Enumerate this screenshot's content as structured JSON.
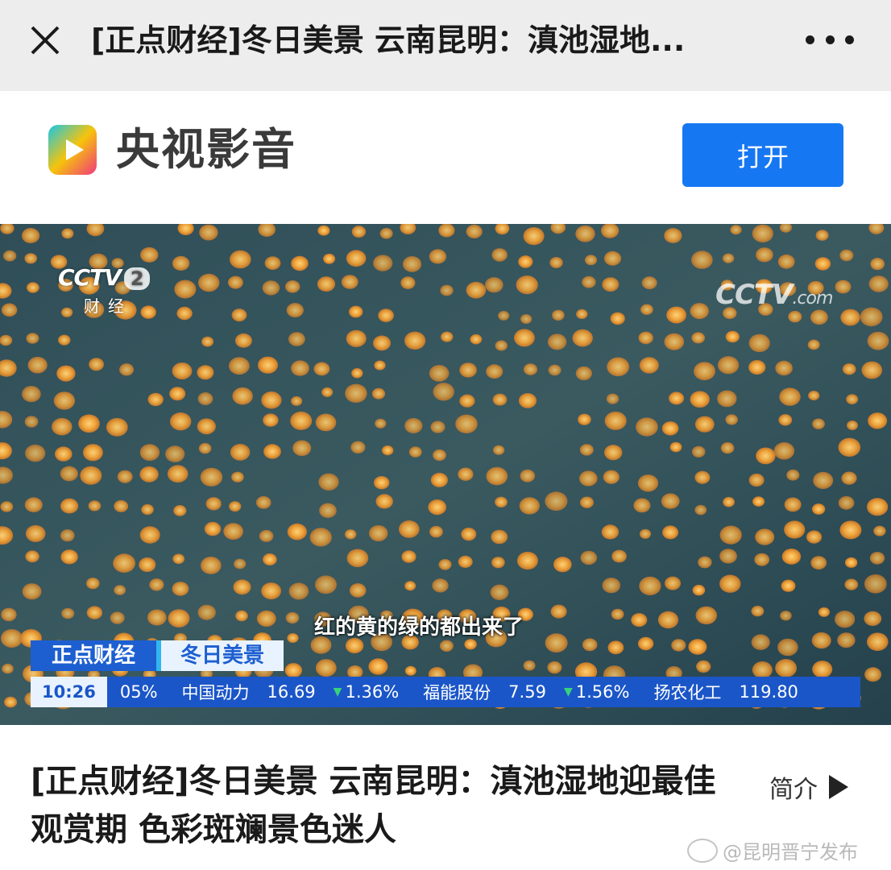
{
  "topbar": {
    "title": "[正点财经]冬日美景 云南昆明：滇池湿地...",
    "close_icon": "close-icon",
    "more_icon": "more-dots-icon"
  },
  "banner": {
    "app_name": "央视影音",
    "open_label": "打开",
    "accent_color": "#1677f2"
  },
  "video": {
    "channel_logo": "CCTV",
    "channel_number": "2",
    "channel_sub": "财经",
    "watermark": "CCTV",
    "watermark_suffix": ".com",
    "subtitle": "红的黄的绿的都出来了",
    "program": "正点财经",
    "segment": "冬日美景",
    "ticker": {
      "time": "10:26",
      "lead_value": "05%",
      "stocks": [
        {
          "name": "中国动力",
          "price": "16.69",
          "change": "1.36%"
        },
        {
          "name": "福能股份",
          "price": "7.59",
          "change": "1.56%"
        },
        {
          "name": "扬农化工",
          "price": "119.80",
          "change": ""
        }
      ]
    }
  },
  "article": {
    "title": "[正点财经]冬日美景 云南昆明：滇池湿地迎最佳观赏期 色彩斑斓景色迷人",
    "intro_label": "简介"
  },
  "watermark": {
    "text": "@昆明晋宁发布"
  }
}
